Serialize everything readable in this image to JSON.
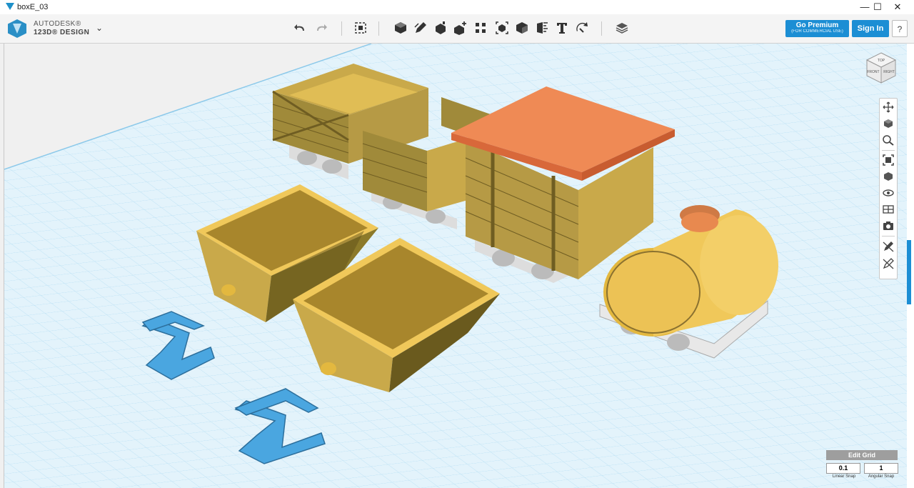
{
  "window": {
    "title": "boxE_03",
    "controls": {
      "minimize": "—",
      "maximize": "☐",
      "close": "✕"
    }
  },
  "brand": {
    "line1": "AUTODESK®",
    "line2": "123D® DESIGN",
    "menu_glyph": "⌄",
    "logo_color": "#2a8fc6"
  },
  "toolbar": {
    "tools": [
      {
        "name": "undo-icon",
        "glyph": "↶"
      },
      {
        "name": "redo-icon",
        "glyph": "↷"
      },
      {
        "name": "transform-icon",
        "glyph": "⬚"
      },
      {
        "name": "primitives-icon",
        "glyph": "■"
      },
      {
        "name": "sketch-icon",
        "glyph": "✎"
      },
      {
        "name": "construct-icon",
        "glyph": "◆"
      },
      {
        "name": "modify-icon",
        "glyph": "✚"
      },
      {
        "name": "pattern-icon",
        "glyph": "⁘"
      },
      {
        "name": "grouping-icon",
        "glyph": "⬚"
      },
      {
        "name": "combine-icon",
        "glyph": "■"
      },
      {
        "name": "measure-icon",
        "glyph": "▤"
      },
      {
        "name": "text-icon",
        "glyph": "T"
      },
      {
        "name": "snap-icon",
        "glyph": "↻"
      },
      {
        "name": "material-icon",
        "glyph": "▦"
      }
    ]
  },
  "account": {
    "premium_label": "Go Premium",
    "premium_sub": "(FOR COMMERCIAL USE)",
    "signin_label": "Sign In",
    "help_label": "?",
    "accent": "#1c8ed4"
  },
  "viewcube": {
    "top": "TOP",
    "front": "FRONT",
    "right": "RIGHT"
  },
  "navbar": {
    "items": [
      "pan-icon",
      "orbit-icon",
      "zoom-icon",
      "fit-icon",
      "views-icon",
      "visibility-icon",
      "materials-icon",
      "camera-icon",
      "edit-icon",
      "snap-tool-icon"
    ]
  },
  "grid_panel": {
    "header": "Edit Grid",
    "linear_value": "0.1",
    "angular_value": "1",
    "linear_label": "Linear Snap",
    "angular_label": "Angular Snap"
  },
  "colors": {
    "grid_bg": "#dff1fb",
    "grid_line": "#a8d6ef",
    "model_yellow": "#f0c85a",
    "model_wood": "#c9a94a",
    "roof": "#ef8a55",
    "clip": "#4aa6e0"
  }
}
